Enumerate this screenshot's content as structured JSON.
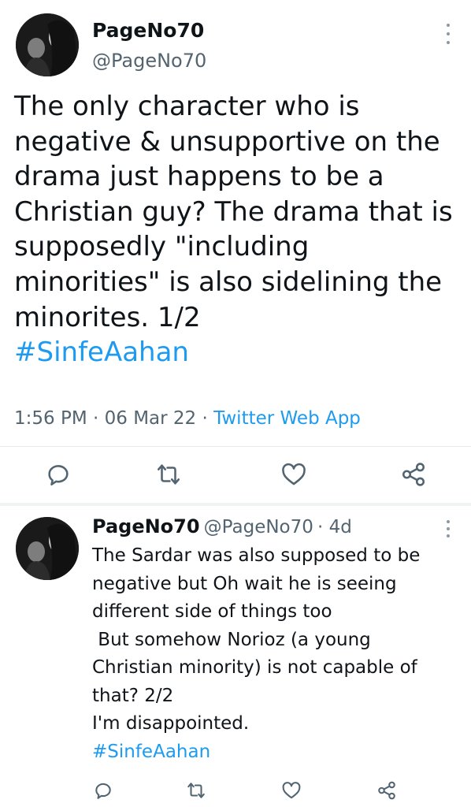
{
  "main_tweet": {
    "display_name": "PageNo70",
    "handle": "@PageNo70",
    "text_lines": [
      "The only character who is",
      "negative & unsupportive on the",
      "drama just happens to be a",
      "Christian guy? The drama that is",
      "supposedly \"including",
      "minorities\" is also sidelining the",
      "minorites. 1/2"
    ],
    "hashtag": "#SinfeAahan",
    "time": "1:56 PM",
    "separator": " · ",
    "date": "06 Mar 22",
    "source": "Twitter Web App",
    "actions": {
      "reply_icon": "comment-icon",
      "retweet_icon": "retweet-icon",
      "like_icon": "heart-icon",
      "share_icon": "share-icon"
    }
  },
  "reply_tweet": {
    "display_name": "PageNo70",
    "handle": "@PageNo70",
    "time_ago": "· 4d",
    "text_lines": [
      "The Sardar was also supposed to be",
      "negative but Oh wait he is seeing",
      "different side of things too",
      " But somehow Norioz (a young",
      "Christian minority) is not capable of",
      "that? 2/2",
      "I'm disappointed."
    ],
    "hashtag": "#SinfeAahan"
  },
  "colors": {
    "link": "#1d9bf0",
    "secondary_text": "#536471",
    "primary_text": "#0f1419",
    "icon": "#536471"
  }
}
